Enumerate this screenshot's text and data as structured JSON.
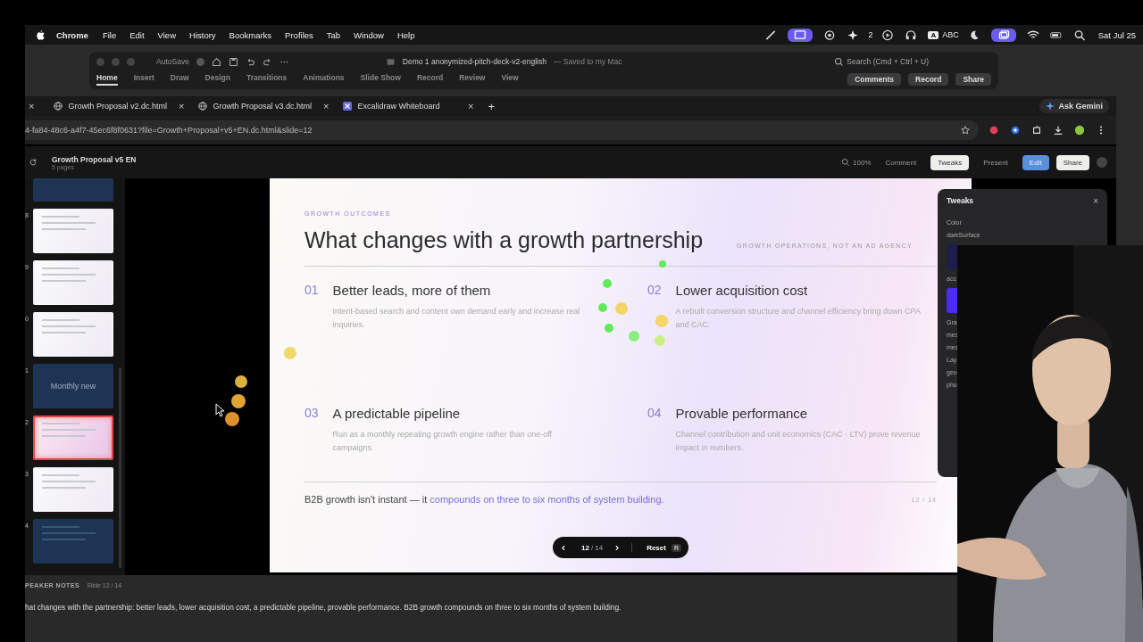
{
  "menubar": {
    "app": "Chrome",
    "menus": [
      "File",
      "Edit",
      "View",
      "History",
      "Bookmarks",
      "Profiles",
      "Tab",
      "Window",
      "Help"
    ],
    "badge": "2",
    "key": "A",
    "input_source": "ABC",
    "clock": "Sat Jul 25"
  },
  "powerpoint": {
    "autosave": "AutoSave",
    "title": "Demo 1 anonymized-pitch-deck-v2-english",
    "saved": "— Saved to my Mac",
    "search": "Search (Cmd + Ctrl + U)",
    "tabs": [
      {
        "label": "Home",
        "selected": true
      },
      {
        "label": "Insert",
        "selected": false
      },
      {
        "label": "Draw",
        "selected": false
      },
      {
        "label": "Design",
        "selected": false
      },
      {
        "label": "Transitions",
        "selected": false
      },
      {
        "label": "Animations",
        "selected": false
      },
      {
        "label": "Slide Show",
        "selected": false
      },
      {
        "label": "Record",
        "selected": false
      },
      {
        "label": "Review",
        "selected": false
      },
      {
        "label": "View",
        "selected": false
      }
    ],
    "buttons": [
      "Comments",
      "Record",
      "Share"
    ]
  },
  "browser": {
    "tabs": [
      {
        "title": "Growth Proposal v2.dc.html",
        "selected": false
      },
      {
        "title": "Growth Proposal v3.dc.html",
        "selected": false
      },
      {
        "title": "Excalidraw Whiteboard",
        "selected": false
      }
    ],
    "close": "×",
    "new_tab": "+",
    "ask": "Ask Gemini",
    "url": "4-fa84-48c6-a4f7-45ec6f8f0631?file=Growth+Proposal+v5+EN.dc.html&slide=12"
  },
  "app": {
    "title": "Growth Proposal v5 EN",
    "subtitle": "5 pages",
    "zoom": "100%",
    "buttons": [
      {
        "label": "Comment",
        "kind": "ghost"
      },
      {
        "label": "Tweaks",
        "kind": "light"
      },
      {
        "label": "Present",
        "kind": "ghost"
      },
      {
        "label": "Edit",
        "kind": "primary"
      },
      {
        "label": "Share",
        "kind": "light"
      }
    ]
  },
  "thumbnails": [
    {
      "kind": "dark",
      "selected": false
    },
    {
      "number": "8",
      "kind": "light",
      "selected": false
    },
    {
      "number": "9",
      "kind": "light",
      "selected": false
    },
    {
      "number": "0",
      "kind": "light",
      "selected": false
    },
    {
      "number": "1",
      "kind": "dark",
      "caption": "Monthly new",
      "selected": false
    },
    {
      "number": "2",
      "kind": "light",
      "selected": true
    },
    {
      "number": "3",
      "kind": "light",
      "selected": false
    },
    {
      "number": "4",
      "kind": "dark",
      "selected": false
    }
  ],
  "slide": {
    "eyebrow": "GROWTH OUTCOMES",
    "title": "What changes with a growth partnership",
    "tagline": "GROWTH OPERATIONS, NOT AN AD AGENCY",
    "items": [
      {
        "number": "01",
        "title": "Better leads, more of them",
        "body": "Intent-based search and content own demand early and increase real inquiries."
      },
      {
        "number": "02",
        "title": "Lower acquisition cost",
        "body": "A rebuilt conversion structure and channel efficiency bring down CPA and CAC."
      },
      {
        "number": "03",
        "title": "A predictable pipeline",
        "body": "Run as a monthly repeating growth engine rather than one-off campaigns."
      },
      {
        "number": "04",
        "title": "Provable performance",
        "body": "Channel contribution and unit economics (CAC · LTV) prove revenue impact in numbers."
      }
    ],
    "footer_lead": "B2B growth isn't instant — it",
    "footer_link": "compounds on three to six months of system building.",
    "page": "12 / 14"
  },
  "pager": {
    "current": "12",
    "total": "/ 14",
    "reset": "Reset",
    "key": "R"
  },
  "tweaks": {
    "title": "Tweaks",
    "close": "×",
    "rows": [
      {
        "kind": "label",
        "text": "Color"
      },
      {
        "kind": "label",
        "text": "darkSurface"
      },
      {
        "kind": "swatch",
        "color": "#1c1f4a"
      },
      {
        "kind": "label",
        "text": "acc"
      },
      {
        "kind": "swatch",
        "color": "#4b2cf0"
      },
      {
        "kind": "label",
        "text": "Gra"
      },
      {
        "kind": "label",
        "text": "mes"
      },
      {
        "kind": "label",
        "text": "mes"
      },
      {
        "kind": "label",
        "text": "Lay"
      },
      {
        "kind": "label",
        "text": "geo"
      },
      {
        "kind": "label",
        "text": "pho"
      }
    ]
  },
  "notes": {
    "heading": "PEAKER NOTES",
    "slide": "Slide 12 / 14",
    "text": "hat changes with the partnership: better leads, lower acquisition cost, a predictable pipeline, provable performance. B2B growth compounds on three to six months of system building."
  }
}
